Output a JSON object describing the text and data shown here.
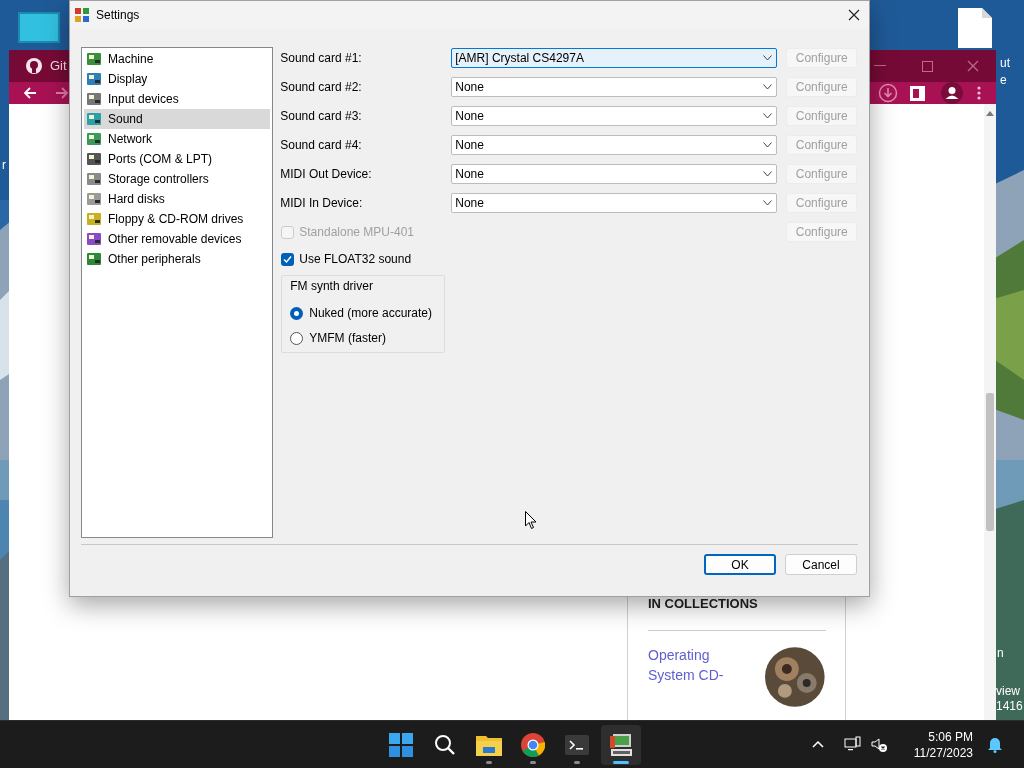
{
  "desktop": {
    "label_fragments": [
      {
        "text": "r"
      },
      {
        "text": "ut"
      },
      {
        "text": "e"
      },
      {
        "text": "n"
      },
      {
        "text": "view"
      },
      {
        "text": "1416"
      }
    ]
  },
  "browser": {
    "tab_title": "Git",
    "collections": {
      "heading": "IN COLLECTIONS",
      "link": "Operating System CD-"
    }
  },
  "dialog": {
    "title": "Settings",
    "sidebar": [
      {
        "label": "Machine",
        "selected": false
      },
      {
        "label": "Display",
        "selected": false
      },
      {
        "label": "Input devices",
        "selected": false
      },
      {
        "label": "Sound",
        "selected": true
      },
      {
        "label": "Network",
        "selected": false
      },
      {
        "label": "Ports (COM & LPT)",
        "selected": false
      },
      {
        "label": "Storage controllers",
        "selected": false
      },
      {
        "label": "Hard disks",
        "selected": false
      },
      {
        "label": "Floppy & CD-ROM drives",
        "selected": false
      },
      {
        "label": "Other removable devices",
        "selected": false
      },
      {
        "label": "Other peripherals",
        "selected": false
      }
    ],
    "devices": [
      {
        "label": "Sound card #1:",
        "value": "[AMR] Crystal CS4297A",
        "focused": true,
        "configure": "Configure",
        "configure_disabled": true
      },
      {
        "label": "Sound card #2:",
        "value": "None",
        "focused": false,
        "configure": "Configure",
        "configure_disabled": true
      },
      {
        "label": "Sound card #3:",
        "value": "None",
        "focused": false,
        "configure": "Configure",
        "configure_disabled": true
      },
      {
        "label": "Sound card #4:",
        "value": "None",
        "focused": false,
        "configure": "Configure",
        "configure_disabled": true
      },
      {
        "label": "MIDI Out Device:",
        "value": "None",
        "focused": false,
        "configure": "Configure",
        "configure_disabled": true
      },
      {
        "label": "MIDI In Device:",
        "value": "None",
        "focused": false,
        "configure": "Configure",
        "configure_disabled": true
      }
    ],
    "standalone_mpu": {
      "label": "Standalone MPU-401",
      "checked": false,
      "disabled": true,
      "configure": "Configure",
      "configure_disabled": true
    },
    "float32": {
      "label": "Use FLOAT32 sound",
      "checked": true,
      "disabled": false
    },
    "fm_driver": {
      "title": "FM synth driver",
      "options": [
        {
          "label": "Nuked (more accurate)",
          "selected": true
        },
        {
          "label": "YMFM (faster)",
          "selected": false
        }
      ]
    },
    "buttons": [
      {
        "label": "OK",
        "default": true
      },
      {
        "label": "Cancel",
        "default": false
      }
    ]
  },
  "taskbar": {
    "apps": [
      {
        "kind": "start",
        "running": false,
        "active": false
      },
      {
        "kind": "search",
        "running": false,
        "active": false
      },
      {
        "kind": "files",
        "running": true,
        "active": false
      },
      {
        "kind": "chrome",
        "running": true,
        "active": false
      },
      {
        "kind": "terminal",
        "running": true,
        "active": false
      },
      {
        "kind": "emulator",
        "running": true,
        "active": true
      }
    ],
    "clock": {
      "time": "5:06 PM",
      "date": "11/27/2023"
    }
  }
}
